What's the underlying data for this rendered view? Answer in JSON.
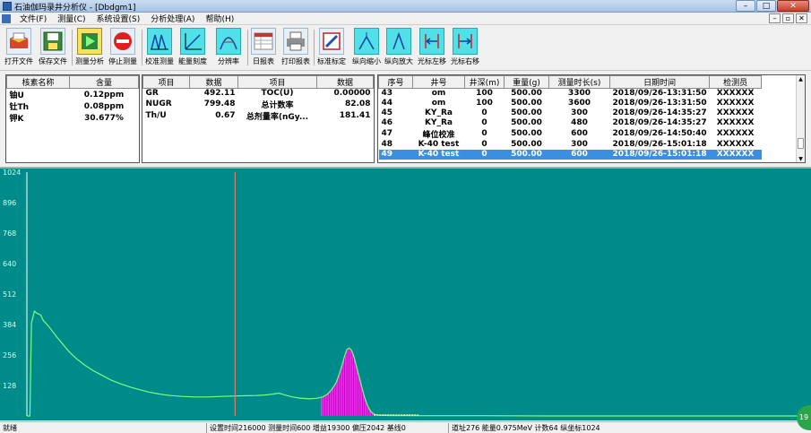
{
  "window": {
    "title": "石油伽玛录井分析仪 - [Dbdgm1]"
  },
  "menu": [
    "文件(F)",
    "测量(C)",
    "系统设置(S)",
    "分析处理(A)",
    "帮助(H)"
  ],
  "toolbar": [
    {
      "label": "打开文件",
      "icon": "open-file-icon"
    },
    {
      "label": "保存文件",
      "icon": "save-file-icon"
    },
    {
      "label": "测量分析",
      "icon": "play-icon"
    },
    {
      "label": "停止测量",
      "icon": "stop-icon"
    },
    {
      "label": "校准测量",
      "icon": "calibrate-icon"
    },
    {
      "label": "能量刻度",
      "icon": "energy-scale-icon"
    },
    {
      "label": "分辨率",
      "icon": "resolution-icon"
    },
    {
      "label": "日报表",
      "icon": "daily-report-icon"
    },
    {
      "label": "打印报表",
      "icon": "print-icon"
    },
    {
      "label": "标准标定",
      "icon": "standard-calibrate-icon"
    },
    {
      "label": "纵向缩小",
      "icon": "zoom-out-vertical-icon"
    },
    {
      "label": "纵向放大",
      "icon": "zoom-in-vertical-icon"
    },
    {
      "label": "光标左移",
      "icon": "cursor-left-icon"
    },
    {
      "label": "光标右移",
      "icon": "cursor-right-icon"
    }
  ],
  "nuclide_table": {
    "headers": [
      "核素名称",
      "含量"
    ],
    "rows": [
      [
        "铀U",
        "0.12ppm"
      ],
      [
        "钍Th",
        "0.08ppm"
      ],
      [
        "钾K",
        "30.677%"
      ]
    ]
  },
  "params_table": {
    "headers": [
      "项目",
      "数据",
      "项目",
      "数据"
    ],
    "rows": [
      [
        "GR",
        "492.11",
        "TOC(U)",
        "0.00000"
      ],
      [
        "NUGR",
        "799.48",
        "总计数率",
        "82.08"
      ],
      [
        "Th/U",
        "0.67",
        "总剂量率(nGy...",
        "181.41"
      ]
    ]
  },
  "records_table": {
    "headers": [
      "序号",
      "井号",
      "井深(m)",
      "重量(g)",
      "测量时长(s)",
      "日期时间",
      "检测员"
    ],
    "rows": [
      [
        "43",
        "om",
        "100",
        "500.00",
        "3300",
        "2018/09/26-13:31:50",
        "XXXXXX"
      ],
      [
        "44",
        "om",
        "100",
        "500.00",
        "3600",
        "2018/09/26-13:31:50",
        "XXXXXX"
      ],
      [
        "45",
        "KY_Ra",
        "0",
        "500.00",
        "300",
        "2018/09/26-14:35:27",
        "XXXXXX"
      ],
      [
        "46",
        "KY_Ra",
        "0",
        "500.00",
        "480",
        "2018/09/26-14:35:27",
        "XXXXXX"
      ],
      [
        "47",
        "峰位校准",
        "0",
        "500.00",
        "600",
        "2018/09/26-14:50:40",
        "XXXXXX"
      ],
      [
        "48",
        "K-40 test",
        "0",
        "500.00",
        "300",
        "2018/09/26-15:01:18",
        "XXXXXX"
      ],
      [
        "49",
        "K-40 test",
        "0",
        "500.00",
        "600",
        "2018/09/26-15:01:18",
        "XXXXXX"
      ]
    ],
    "selected_index": 6
  },
  "chart_data": {
    "type": "line",
    "y_ticks": [
      "1024",
      "896",
      "768",
      "640",
      "512",
      "384",
      "256",
      "128"
    ],
    "ylim": [
      0,
      1024
    ],
    "xlim": [
      0,
      1024
    ],
    "cursor_channel": 276,
    "peak_region": [
      390,
      460
    ],
    "spectrum_points": [
      [
        0,
        0
      ],
      [
        4,
        0
      ],
      [
        6,
        390
      ],
      [
        10,
        440
      ],
      [
        14,
        430
      ],
      [
        18,
        425
      ],
      [
        22,
        400
      ],
      [
        28,
        380
      ],
      [
        34,
        355
      ],
      [
        40,
        330
      ],
      [
        48,
        300
      ],
      [
        56,
        270
      ],
      [
        66,
        240
      ],
      [
        76,
        215
      ],
      [
        88,
        190
      ],
      [
        100,
        170
      ],
      [
        112,
        150
      ],
      [
        124,
        135
      ],
      [
        138,
        120
      ],
      [
        150,
        110
      ],
      [
        162,
        100
      ],
      [
        176,
        92
      ],
      [
        190,
        86
      ],
      [
        206,
        82
      ],
      [
        222,
        80
      ],
      [
        240,
        80
      ],
      [
        258,
        82
      ],
      [
        276,
        84
      ],
      [
        292,
        85
      ],
      [
        304,
        86
      ],
      [
        316,
        88
      ],
      [
        326,
        92
      ],
      [
        334,
        96
      ],
      [
        342,
        88
      ],
      [
        352,
        80
      ],
      [
        362,
        75
      ],
      [
        374,
        72
      ],
      [
        384,
        74
      ],
      [
        392,
        80
      ],
      [
        398,
        90
      ],
      [
        404,
        110
      ],
      [
        410,
        140
      ],
      [
        414,
        175
      ],
      [
        418,
        215
      ],
      [
        421,
        250
      ],
      [
        424,
        278
      ],
      [
        427,
        285
      ],
      [
        430,
        278
      ],
      [
        433,
        255
      ],
      [
        436,
        220
      ],
      [
        440,
        170
      ],
      [
        444,
        120
      ],
      [
        448,
        75
      ],
      [
        452,
        40
      ],
      [
        456,
        18
      ],
      [
        460,
        8
      ],
      [
        466,
        3
      ],
      [
        480,
        2
      ],
      [
        520,
        1
      ],
      [
        600,
        1
      ],
      [
        700,
        0
      ],
      [
        800,
        0
      ],
      [
        1024,
        0
      ]
    ],
    "line_color": "#7bff7b",
    "peak_color": "#cc00cc",
    "background": "#008b8b"
  },
  "status": {
    "ready": "就绪",
    "meas": "设置时间216000 测量时间600 增益19300 偏压2042 基线0",
    "cursor": "道址276 能量0.975MeV 计数64 纵坐标1024"
  },
  "badge": "19"
}
